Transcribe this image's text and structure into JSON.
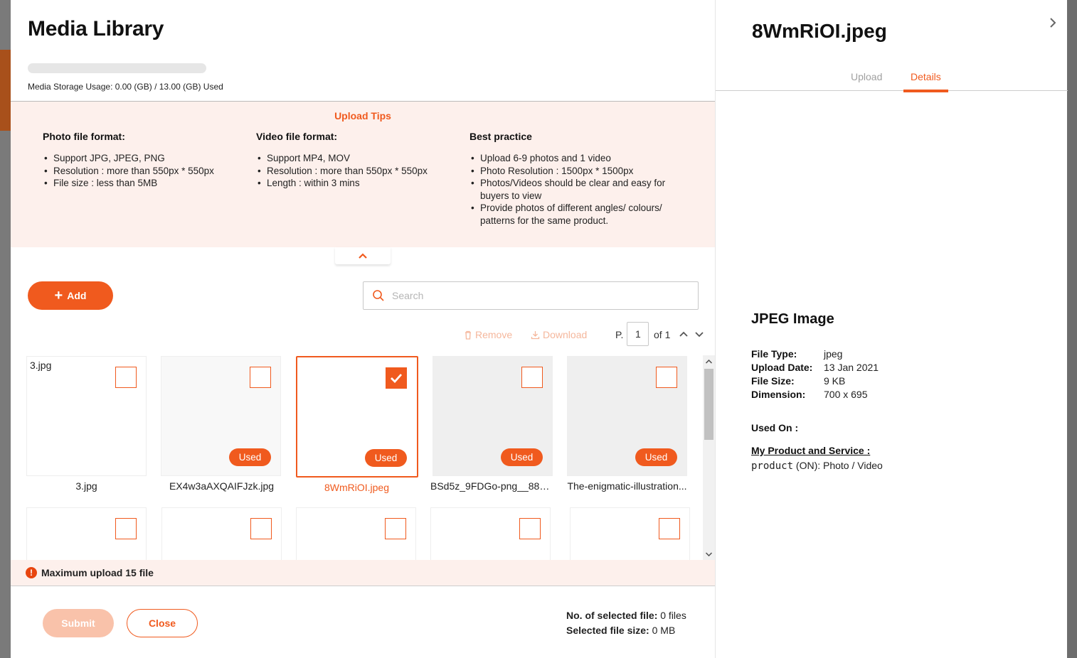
{
  "modal": {
    "title": "Media Library",
    "storage_text": "Media Storage Usage: 0.00 (GB) / 13.00 (GB) Used",
    "storage_fraction": 0.0
  },
  "tips": {
    "title": "Upload Tips",
    "columns": [
      {
        "heading": "Photo file format:",
        "items": [
          "Support JPG, JPEG, PNG",
          "Resolution : more than 550px * 550px",
          "File size : less than 5MB"
        ]
      },
      {
        "heading": "Video file format:",
        "items": [
          "Support MP4, MOV",
          "Resolution : more than 550px * 550px",
          "Length : within 3 mins"
        ]
      },
      {
        "heading": "Best practice",
        "items": [
          "Upload 6-9 photos and 1 video",
          "Photo Resolution : 1500px * 1500px",
          "Photos/Videos should be clear and easy for buyers to view",
          "Provide photos of different angles/ colours/ patterns for the same product."
        ]
      }
    ]
  },
  "toolbar": {
    "add_label": "Add",
    "search_placeholder": "Search",
    "remove_label": "Remove",
    "download_label": "Download",
    "page_prefix": "P.",
    "page_value": "1",
    "page_of": "of 1"
  },
  "files": [
    {
      "name": "3.jpg",
      "inner_name": "3.jpg",
      "caption": "3.jpg",
      "used": false,
      "checked": false
    },
    {
      "name": "EX4w3aAXQAIFJzk.jpg",
      "caption": "EX4w3aAXQAIFJzk.jpg",
      "used": true,
      "checked": false,
      "used_label": "Used"
    },
    {
      "name": "8WmRiOI.jpeg",
      "caption": "8WmRiOI.jpeg",
      "used": true,
      "checked": true,
      "used_label": "Used"
    },
    {
      "name": "BSd5z_9FDGo-png__880....",
      "caption": "BSd5z_9FDGo-png__880....",
      "used": true,
      "checked": false,
      "used_label": "Used"
    },
    {
      "name": "The-enigmatic-illustration...",
      "caption": "The-enigmatic-illustration...",
      "used": true,
      "checked": false,
      "used_label": "Used"
    }
  ],
  "footer": {
    "warning": "Maximum upload 15 file",
    "submit_label": "Submit",
    "close_label": "Close",
    "selected_count_label": "No. of selected file:",
    "selected_count_value": "0 files",
    "selected_size_label": "Selected file size:",
    "selected_size_value": "0 MB"
  },
  "panel": {
    "title": "8WmRiOI.jpeg",
    "tabs": [
      "Upload",
      "Details"
    ],
    "active_tab": "Details",
    "type_heading": "JPEG Image",
    "details": [
      {
        "label": "File Type:",
        "value": "jpeg"
      },
      {
        "label": "Upload Date:",
        "value": "13 Jan 2021"
      },
      {
        "label": "File Size:",
        "value": "9 KB"
      },
      {
        "label": "Dimension:",
        "value": "700 x 695"
      }
    ],
    "used_on_label": "Used On :",
    "used_section": "My Product and Service :",
    "used_line_code": "product",
    "used_line_rest": " (ON): Photo / Video"
  },
  "colors": {
    "accent": "#f05a1e",
    "tips_bg": "#fdf0ec",
    "submit_disabled": "#f9c2aa"
  }
}
